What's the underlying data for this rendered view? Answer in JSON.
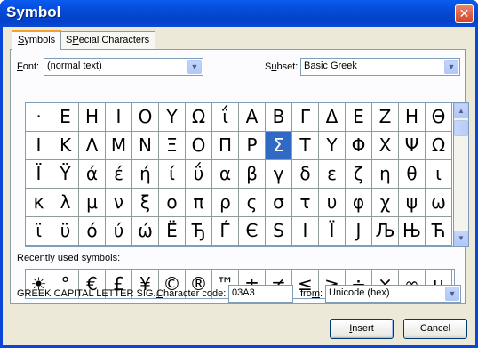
{
  "window": {
    "title": "Symbol",
    "close_glyph": "✕"
  },
  "tabs": [
    {
      "label": "Symbols",
      "underline": "S",
      "rest": "ymbols"
    },
    {
      "label": "Special Characters",
      "underline": "P",
      "pre": "S",
      "rest": "ecial Characters"
    }
  ],
  "font": {
    "label_u": "F",
    "label_rest": "ont:",
    "value": "(normal text)"
  },
  "subset": {
    "label_pre": "S",
    "label_u": "u",
    "label_rest": "bset:",
    "value": "Basic Greek"
  },
  "symbols": [
    [
      "·",
      "Ε",
      "Η",
      "Ι",
      "Ο",
      "Υ",
      "Ω",
      "ΐ",
      "Α",
      "Β",
      "Γ",
      "Δ",
      "Ε",
      "Ζ",
      "Η",
      "Θ"
    ],
    [
      "Ι",
      "Κ",
      "Λ",
      "Μ",
      "Ν",
      "Ξ",
      "Ο",
      "Π",
      "Ρ",
      "Σ",
      "Τ",
      "Υ",
      "Φ",
      "Χ",
      "Ψ",
      "Ω"
    ],
    [
      "Ϊ",
      "Ϋ",
      "ά",
      "έ",
      "ή",
      "ί",
      "ΰ",
      "α",
      "β",
      "γ",
      "δ",
      "ε",
      "ζ",
      "η",
      "θ",
      "ι"
    ],
    [
      "κ",
      "λ",
      "μ",
      "ν",
      "ξ",
      "ο",
      "π",
      "ρ",
      "ς",
      "σ",
      "τ",
      "υ",
      "φ",
      "χ",
      "ψ",
      "ω"
    ],
    [
      "ϊ",
      "ϋ",
      "ό",
      "ύ",
      "ώ",
      "Ë",
      "Ђ",
      "Ѓ",
      "Є",
      "S",
      "I",
      "Ï",
      "J",
      "Љ",
      "Њ",
      "Ћ"
    ]
  ],
  "selected": {
    "row": 1,
    "col": 9
  },
  "recent": {
    "label": "Recently used symbols:",
    "symbols": [
      "☀",
      "°",
      "€",
      "£",
      "¥",
      "©",
      "®",
      "™",
      "±",
      "≠",
      "≤",
      "≥",
      "÷",
      "×",
      "∞",
      "µ"
    ]
  },
  "char_name": "GREEK CAPITAL LETTER SIG...",
  "char_code": {
    "label_u": "C",
    "label_rest": "haracter code:",
    "value": "03A3"
  },
  "from": {
    "label_pre": "fro",
    "label_u": "m",
    "label_rest": ":",
    "value": "Unicode (hex)"
  },
  "buttons": {
    "insert_u": "I",
    "insert_rest": "nsert",
    "cancel": "Cancel"
  },
  "scroll": {
    "up": "▲",
    "down": "▼"
  },
  "dropdown_glyph": "▼"
}
